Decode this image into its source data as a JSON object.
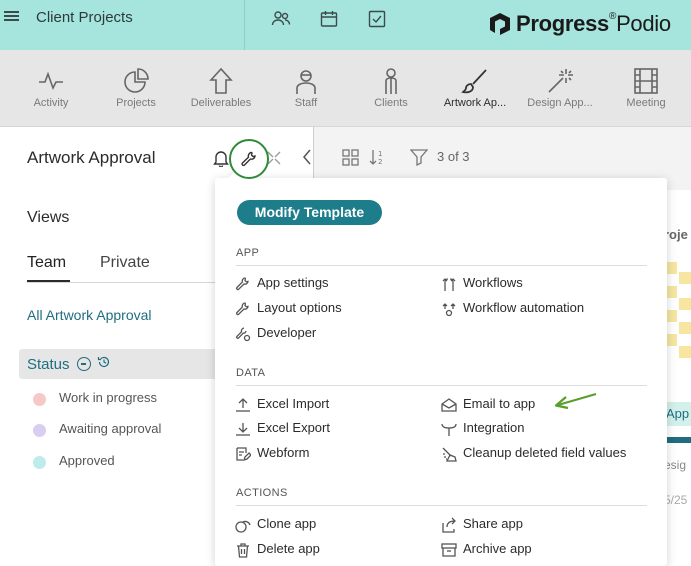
{
  "workspace": {
    "title": "Client Projects"
  },
  "apps": [
    {
      "label": "Activity",
      "icon": "activity-icon"
    },
    {
      "label": "Projects",
      "icon": "pie-chart-icon"
    },
    {
      "label": "Deliverables",
      "icon": "upload-arrow-icon"
    },
    {
      "label": "Staff",
      "icon": "person-icon"
    },
    {
      "label": "Clients",
      "icon": "client-icon"
    },
    {
      "label": "Artwork Ap...",
      "icon": "paintbrush-icon",
      "active": true
    },
    {
      "label": "Design App...",
      "icon": "magic-wand-icon"
    },
    {
      "label": "Meeting",
      "icon": "film-icon"
    }
  ],
  "logo": {
    "word1": "Progress",
    "word2": "Podio"
  },
  "left_panel": {
    "title": "Artwork Approval",
    "views_heading": "Views",
    "tabs": [
      "Team",
      "Private"
    ],
    "all_link": "All Artwork Approval",
    "status_label": "Status",
    "statuses": [
      {
        "label": "Work in progress",
        "color": "#f7c8c8"
      },
      {
        "label": "Awaiting approval",
        "color": "#d9cdf2"
      },
      {
        "label": "Approved",
        "color": "#bdecea"
      }
    ]
  },
  "toolbar": {
    "count": "3 of 3"
  },
  "card_peek": {
    "title": "roje",
    "badge": "App",
    "subtitle": "esig",
    "date": "5/25"
  },
  "dropdown": {
    "modify_template": "Modify Template",
    "sections": [
      {
        "title": "APP",
        "left": [
          {
            "label": "App settings",
            "icon": "wrench-icon"
          },
          {
            "label": "Layout options",
            "icon": "wrench-icon"
          },
          {
            "label": "Developer",
            "icon": "developer-icon"
          }
        ],
        "right": [
          {
            "label": "Workflows",
            "icon": "workflows-icon"
          },
          {
            "label": "Workflow automation",
            "icon": "automation-icon"
          }
        ]
      },
      {
        "title": "DATA",
        "left": [
          {
            "label": "Excel Import",
            "icon": "import-icon"
          },
          {
            "label": "Excel Export",
            "icon": "export-icon"
          },
          {
            "label": "Webform",
            "icon": "webform-icon"
          }
        ],
        "right": [
          {
            "label": "Email to app",
            "icon": "envelope-icon"
          },
          {
            "label": "Integration",
            "icon": "integration-icon"
          },
          {
            "label": "Cleanup deleted field values",
            "icon": "cleanup-icon"
          }
        ]
      },
      {
        "title": "ACTIONS",
        "left": [
          {
            "label": "Clone app",
            "icon": "clone-icon"
          },
          {
            "label": "Delete app",
            "icon": "trash-icon"
          }
        ],
        "right": [
          {
            "label": "Share app",
            "icon": "share-icon"
          },
          {
            "label": "Archive app",
            "icon": "archive-icon"
          }
        ]
      }
    ]
  },
  "colors": {
    "topbar": "#a6e5dd",
    "accent": "#1e7d8a",
    "link": "#1e6e80",
    "highlight_ring": "#2e8b3a",
    "annotation_arrow": "#5a9e2a"
  }
}
